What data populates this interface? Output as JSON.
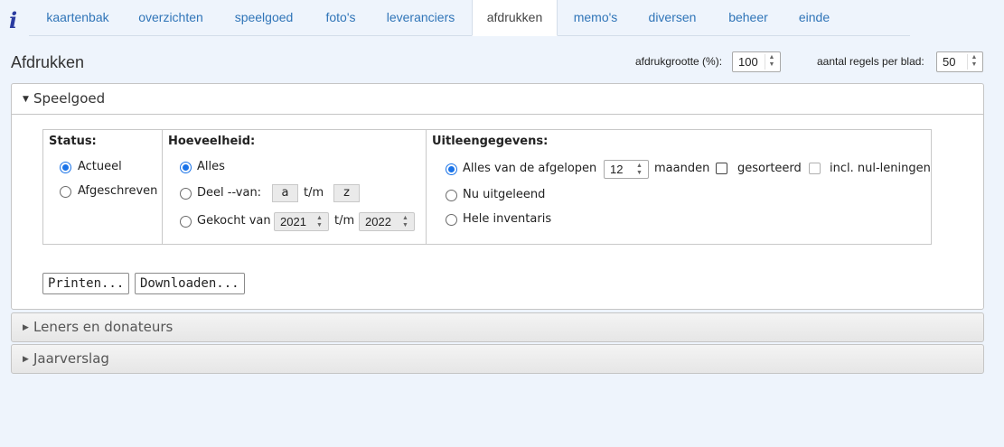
{
  "app": {
    "logo_text": "i"
  },
  "nav": {
    "tabs": [
      {
        "label": "kaartenbak"
      },
      {
        "label": "overzichten"
      },
      {
        "label": "speelgoed"
      },
      {
        "label": "foto's"
      },
      {
        "label": "leveranciers"
      },
      {
        "label": "afdrukken",
        "active": true
      },
      {
        "label": "memo's"
      },
      {
        "label": "diversen"
      },
      {
        "label": "beheer"
      },
      {
        "label": "einde"
      }
    ]
  },
  "header": {
    "title": "Afdrukken",
    "print_size_label": "afdrukgrootte (%):",
    "print_size_value": "100",
    "rows_per_page_label": "aantal regels per blad:",
    "rows_per_page_value": "50"
  },
  "panels": [
    {
      "title": "Speelgoed",
      "open": true
    },
    {
      "title": "Leners en donateurs",
      "open": false
    },
    {
      "title": "Jaarverslag",
      "open": false
    }
  ],
  "status": {
    "title": "Status:",
    "options": [
      {
        "label": "Actueel",
        "selected": true
      },
      {
        "label": "Afgeschreven",
        "selected": false
      }
    ]
  },
  "quantity": {
    "title": "Hoeveelheid:",
    "all_label": "Alles",
    "part_label": "Deel --van:",
    "part_from": "a",
    "part_sep": "t/m",
    "part_to": "z",
    "bought_label": "Gekocht van",
    "bought_from": "2021",
    "bought_sep": "t/m",
    "bought_to": "2022"
  },
  "loan": {
    "title": "Uitleengegevens:",
    "all_label": "Alles van de afgelopen",
    "months_value": "12",
    "months_label": "maanden",
    "sorted_label": "gesorteerd",
    "nil_label": "incl. nul-leningen",
    "now_label": "Nu uitgeleend",
    "inventory_label": "Hele inventaris"
  },
  "actions": {
    "print_label": "Printen...",
    "download_label": "Downloaden..."
  },
  "colors": {
    "background": "#eef4fc",
    "link": "#3075b8",
    "radio_selected": "#1a73e8"
  }
}
